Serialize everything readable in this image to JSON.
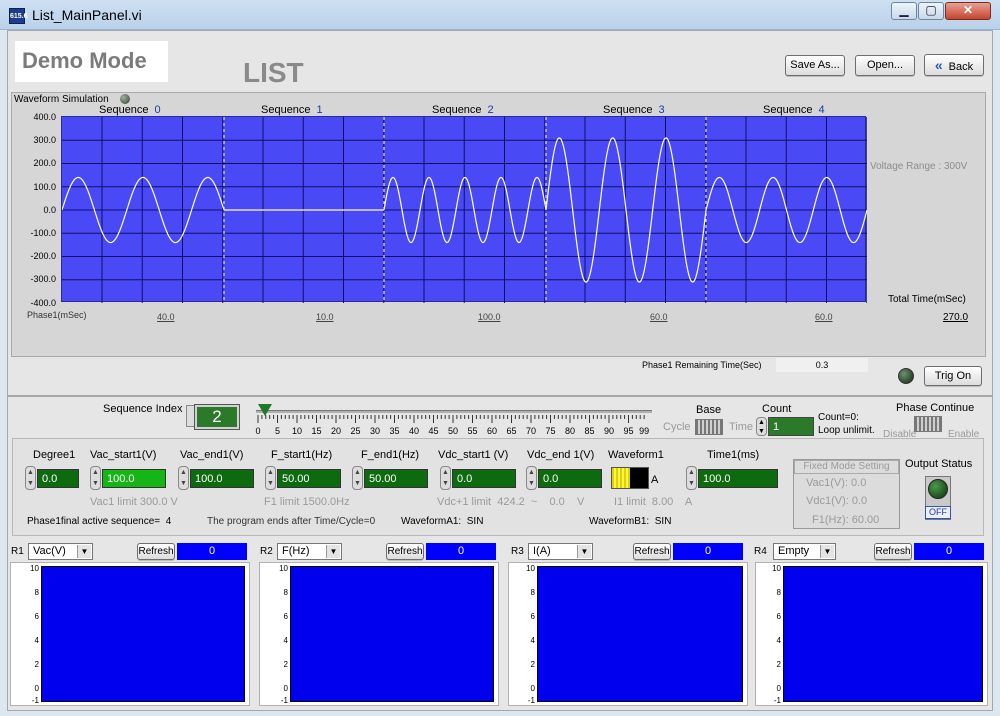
{
  "window": {
    "title": "List_MainPanel.vi",
    "icon_text": "615.6",
    "min_symbol": "▁",
    "max_symbol": "▢",
    "close_symbol": "✕"
  },
  "header": {
    "demo_mode": "Demo Mode",
    "title": "LIST",
    "save_as": "Save As...",
    "open": "Open...",
    "back": "Back",
    "back_icon": "double-chevron-left-icon"
  },
  "graph": {
    "label": "Waveform Simulation",
    "y_ticks": [
      "400.0",
      "300.0",
      "200.0",
      "100.0",
      "0.0",
      "-100.0",
      "-200.0",
      "-300.0",
      "-400.0"
    ],
    "sequences": [
      {
        "label": "Sequence",
        "num": "0"
      },
      {
        "label": "Sequence",
        "num": "1"
      },
      {
        "label": "Sequence",
        "num": "2"
      },
      {
        "label": "Sequence",
        "num": "3"
      },
      {
        "label": "Sequence",
        "num": "4"
      }
    ],
    "segment_times": [
      "40.0",
      "10.0",
      "100.0",
      "60.0",
      "60.0"
    ],
    "phase_unit": "Phase1(mSec)",
    "voltage_range": "Voltage Range : 300V",
    "total_time_label": "Total Time(mSec)",
    "total_time_value": "270.0",
    "remaining_label": "Phase1 Remaining Time(Sec)",
    "remaining_value": "0.3",
    "trig_button": "Trig On"
  },
  "chart_data": {
    "type": "line",
    "title": "",
    "xlabel": "Phase1(mSec)",
    "ylabel": "",
    "ylim": [
      -400,
      400
    ],
    "x_segments_ms": [
      40.0,
      10.0,
      100.0,
      60.0,
      60.0
    ],
    "series": [
      {
        "segments": [
          {
            "sequence": 0,
            "amplitude": 140,
            "cycles": 2.5
          },
          {
            "sequence": 1,
            "amplitude": 0,
            "cycles": 0
          },
          {
            "sequence": 2,
            "amplitude": 140,
            "cycles": 4.5
          },
          {
            "sequence": 3,
            "amplitude": 310,
            "cycles": 3
          },
          {
            "sequence": 4,
            "amplitude": 140,
            "cycles": 3
          }
        ]
      }
    ]
  },
  "sequence_index": {
    "label": "Sequence Index",
    "value": "2",
    "slider_value": 0,
    "slider_ticks": [
      "0",
      "5",
      "10",
      "15",
      "20",
      "25",
      "30",
      "35",
      "40",
      "45",
      "50",
      "55",
      "60",
      "65",
      "70",
      "75",
      "80",
      "85",
      "90",
      "95",
      "99"
    ]
  },
  "base": {
    "label": "Base",
    "cycle": "Cycle",
    "time": "Time"
  },
  "count": {
    "label": "Count",
    "value": "1",
    "note1": "Count=0:",
    "note2": "Loop unlimit."
  },
  "phase_continue": {
    "label": "Phase Continue",
    "disable": "Disable",
    "enable": "Enable"
  },
  "params": {
    "degree1": {
      "label": "Degree1",
      "value": "0.0"
    },
    "vac_start1": {
      "label": "Vac_start1(V)",
      "value": "100.0"
    },
    "vac_end1": {
      "label": "Vac_end1(V)",
      "value": "100.0"
    },
    "f_start1": {
      "label": "F_start1(Hz)",
      "value": "50.00"
    },
    "f_end1": {
      "label": "F_end1(Hz)",
      "value": "50.00"
    },
    "vdc_start1": {
      "label": "Vdc_start1 (V)",
      "value": "0.0"
    },
    "vdc_end1": {
      "label": "Vdc_end 1(V)",
      "value": "0.0"
    },
    "waveform1": {
      "label": "Waveform1",
      "value": "A"
    },
    "time1": {
      "label": "Time1(ms)",
      "value": "100.0"
    },
    "vac1_limit": "Vac1 limit  300.0 V",
    "f1_limit": "F1 limit   1500.0Hz",
    "vdc_limit": "Vdc+1 limit  424.2  ~    0.0    V",
    "i1_limit": "I1 limit  8.00    A"
  },
  "fixed_mode": {
    "title": "Fixed Mode Setting",
    "vac": "Vac1(V):  0.0",
    "vdc": "Vdc1(V):  0.0",
    "f": "F1(Hz):  60.00"
  },
  "output_status": {
    "label": "Output Status",
    "state": "OFF"
  },
  "status_line": {
    "final_seq_label": "Phase1final active sequence=",
    "final_seq_value": "4",
    "program_ends": "The program ends after Time/Cycle=0",
    "wave_a1_label": "WaveformA1:",
    "wave_a1_value": "SIN",
    "wave_b1_label": "WaveformB1:",
    "wave_b1_value": "SIN"
  },
  "monitors": [
    {
      "id": "R1",
      "select": "Vac(V)",
      "refresh": "Refresh",
      "value": "0"
    },
    {
      "id": "R2",
      "select": "F(Hz)",
      "refresh": "Refresh",
      "value": "0"
    },
    {
      "id": "R3",
      "select": "I(A)",
      "refresh": "Refresh",
      "value": "0"
    },
    {
      "id": "R4",
      "select": "Empty",
      "refresh": "Refresh",
      "value": "0"
    }
  ],
  "monitor_ticks": [
    "10",
    "8",
    "6",
    "4",
    "2",
    "0",
    "-1"
  ],
  "colors": {
    "plot_bg": "#4949f5",
    "monitor_bg": "#0000ee",
    "led_green": "#0e6a0e"
  }
}
